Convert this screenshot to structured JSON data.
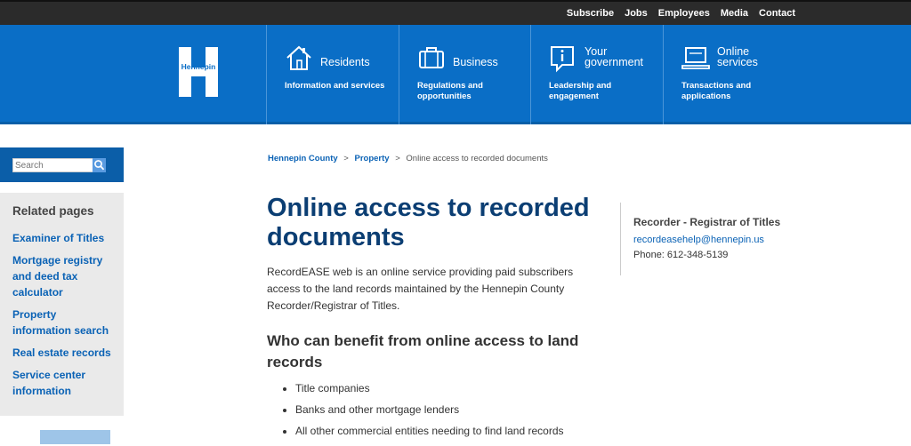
{
  "top_links": [
    "Subscribe",
    "Jobs",
    "Employees",
    "Media",
    "Contact"
  ],
  "logo_text": "Hennepin",
  "nav": [
    {
      "title": "Residents",
      "desc": "Information and services",
      "icon": "house-icon"
    },
    {
      "title": "Business",
      "desc": "Regulations and opportunities",
      "icon": "briefcase-icon"
    },
    {
      "title": "Your government",
      "desc": "Leadership and engagement",
      "icon": "info-bubble-icon"
    },
    {
      "title": "Online services",
      "desc": "Transactions and applications",
      "icon": "laptop-icon"
    }
  ],
  "search": {
    "placeholder": "Search"
  },
  "related": {
    "heading": "Related pages",
    "links": [
      "Examiner of Titles",
      "Mortgage registry and deed tax calculator",
      "Property information search",
      "Real estate records",
      "Service center information"
    ]
  },
  "breadcrumb": {
    "home": "Hennepin County",
    "section": "Property",
    "current": "Online access to recorded documents"
  },
  "title": "Online access to recorded documents",
  "intro": "RecordEASE web is an online service providing paid subscribers access to the land records maintained by the Hennepin County Recorder/Registrar of Titles.",
  "benefit_heading": "Who can benefit from online access to land records",
  "benefits": [
    "Title companies",
    "Banks and other mortgage lenders",
    "All other commercial entities needing to find land records"
  ],
  "contact": {
    "heading": "Recorder - Registrar of Titles",
    "email": "recordeasehelp@hennepin.us",
    "phone": "Phone: 612-348-5139"
  }
}
